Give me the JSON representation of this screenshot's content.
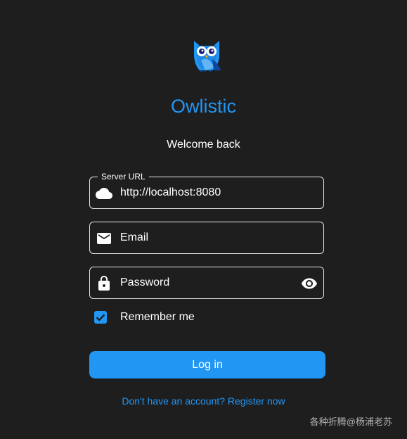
{
  "app": {
    "title": "Owlistic",
    "subtitle": "Welcome back",
    "logo_icon": "owl-logo-icon"
  },
  "form": {
    "server_url": {
      "label": "Server URL",
      "value": "http://localhost:8080",
      "icon": "cloud-icon"
    },
    "email": {
      "placeholder": "Email",
      "icon": "email-icon"
    },
    "password": {
      "placeholder": "Password",
      "icon": "lock-icon",
      "toggle_icon": "eye-icon"
    },
    "remember_me": {
      "label": "Remember me",
      "checked": true
    },
    "login_label": "Log in",
    "register_link": "Don't have an account? Register now"
  },
  "watermark": "各种折腾@杨浦老苏",
  "colors": {
    "background": "#1e1e1f",
    "accent": "#2196f3",
    "border": "#e6e6e6",
    "text": "#ffffff"
  }
}
